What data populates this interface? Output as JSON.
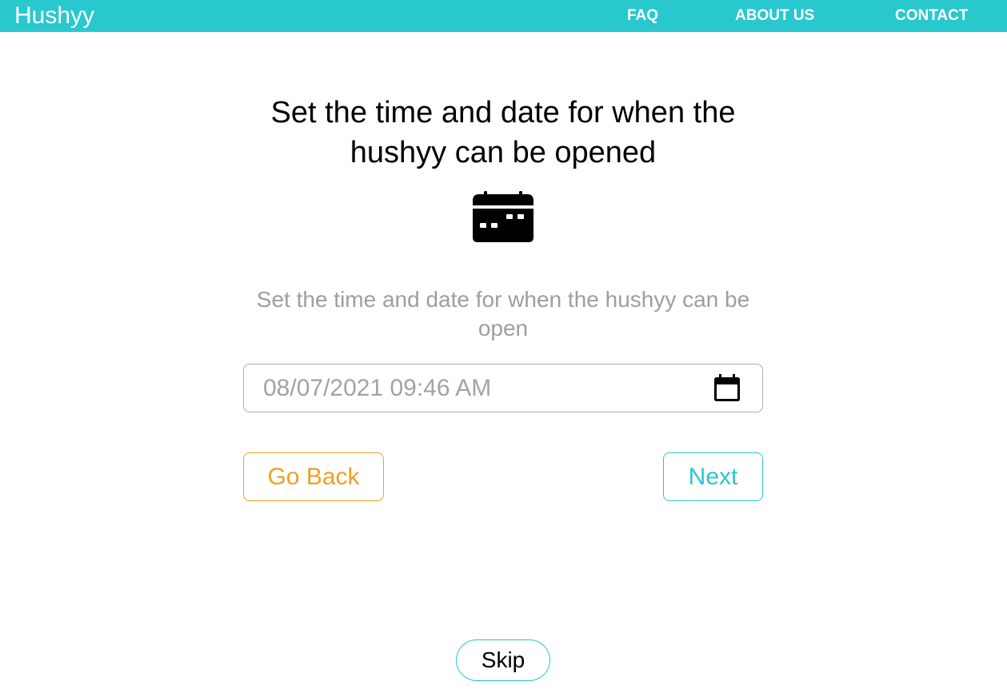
{
  "header": {
    "brand": "Hushyy",
    "nav": {
      "faq": "FAQ",
      "about": "ABOUT US",
      "contact": "CONTACT"
    }
  },
  "main": {
    "heading": "Set the time and date for when the hushyy can be opened",
    "icon": "calendar-icon",
    "subtext": "Set the time and date for when the hushyy can be open",
    "datetime_field": {
      "value": "08/07/2021 09:46 AM",
      "icon": "calendar-picker-icon"
    },
    "buttons": {
      "back": "Go Back",
      "next": "Next",
      "skip": "Skip"
    }
  },
  "colors": {
    "header_bg": "#29c8cf",
    "accent_teal": "#29c8cf",
    "accent_orange": "#f0a024",
    "muted_text": "#9e9e9e"
  }
}
